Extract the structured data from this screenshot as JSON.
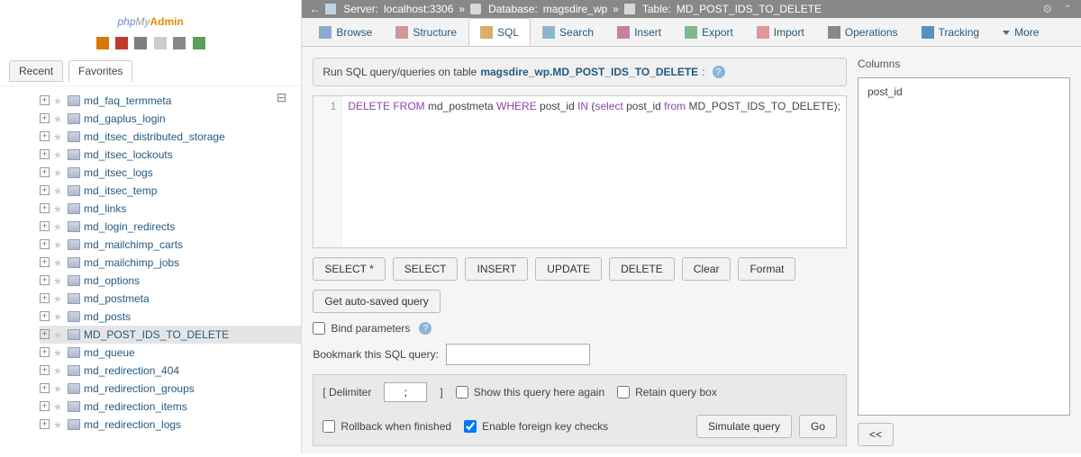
{
  "logo": {
    "p1": "php",
    "p2": "My",
    "p3": "Admin"
  },
  "recent_fav": {
    "recent": "Recent",
    "favorites": "Favorites"
  },
  "tree": [
    {
      "name": "md_faq_termmeta"
    },
    {
      "name": "md_gaplus_login"
    },
    {
      "name": "md_itsec_distributed_storage"
    },
    {
      "name": "md_itsec_lockouts"
    },
    {
      "name": "md_itsec_logs"
    },
    {
      "name": "md_itsec_temp"
    },
    {
      "name": "md_links"
    },
    {
      "name": "md_login_redirects"
    },
    {
      "name": "md_mailchimp_carts"
    },
    {
      "name": "md_mailchimp_jobs"
    },
    {
      "name": "md_options"
    },
    {
      "name": "md_postmeta"
    },
    {
      "name": "md_posts"
    },
    {
      "name": "MD_POST_IDS_TO_DELETE",
      "selected": true
    },
    {
      "name": "md_queue"
    },
    {
      "name": "md_redirection_404"
    },
    {
      "name": "md_redirection_groups"
    },
    {
      "name": "md_redirection_items"
    },
    {
      "name": "md_redirection_logs"
    }
  ],
  "breadcrumb": {
    "server_label": "Server:",
    "server": "localhost:3306",
    "db_label": "Database:",
    "db": "magsdire_wp",
    "table_label": "Table:",
    "table": "MD_POST_IDS_TO_DELETE",
    "sep": "»"
  },
  "tabs": {
    "browse": "Browse",
    "structure": "Structure",
    "sql": "SQL",
    "search": "Search",
    "insert": "Insert",
    "export": "Export",
    "import": "Import",
    "operations": "Operations",
    "tracking": "Tracking",
    "more": "More"
  },
  "query_header": {
    "prefix": "Run SQL query/queries on table ",
    "link": "magsdire_wp.MD_POST_IDS_TO_DELETE",
    ":": ":"
  },
  "sql": {
    "line": "1",
    "t1": "DELETE FROM",
    "t2": " md_postmeta ",
    "t3": "WHERE",
    "t4": " post_id ",
    "t5": "IN",
    "t6": " (",
    "t7": "select",
    "t8": " post_id ",
    "t9": "from",
    "t10": " MD_POST_IDS_TO_DELETE);"
  },
  "buttons": {
    "select_star": "SELECT *",
    "select": "SELECT",
    "insert": "INSERT",
    "update": "UPDATE",
    "delete": "DELETE",
    "clear": "Clear",
    "format": "Format",
    "autosaved": "Get auto-saved query",
    "bind": "Bind parameters",
    "lt": "<<",
    "simulate": "Simulate query",
    "go": "Go"
  },
  "bookmark_label": "Bookmark this SQL query:",
  "footer": {
    "delim_open": "[ Delimiter",
    "delim_val": ";",
    "delim_close": "]",
    "show_again": "Show this query here again",
    "retain": "Retain query box",
    "rollback": "Rollback when finished",
    "fk": "Enable foreign key checks"
  },
  "columns": {
    "label": "Columns",
    "items": [
      "post_id"
    ]
  }
}
